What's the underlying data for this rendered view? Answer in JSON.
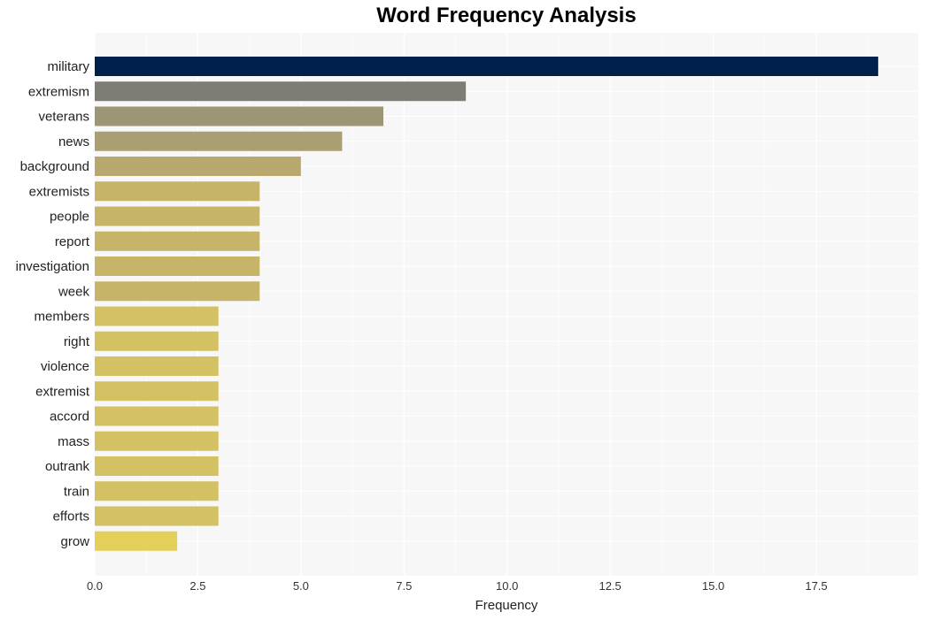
{
  "chart_data": {
    "type": "bar",
    "orientation": "horizontal",
    "title": "Word Frequency Analysis",
    "xlabel": "Frequency",
    "ylabel": "",
    "xlim": [
      0,
      20
    ],
    "xticks": [
      0.0,
      2.5,
      5.0,
      7.5,
      10.0,
      12.5,
      15.0,
      17.5
    ],
    "xtick_labels": [
      "0.0",
      "2.5",
      "5.0",
      "7.5",
      "10.0",
      "12.5",
      "15.0",
      "17.5"
    ],
    "grid": true,
    "categories": [
      "military",
      "extremism",
      "veterans",
      "news",
      "background",
      "extremists",
      "people",
      "report",
      "investigation",
      "week",
      "members",
      "right",
      "violence",
      "extremist",
      "accord",
      "mass",
      "outrank",
      "train",
      "efforts",
      "grow"
    ],
    "values": [
      19,
      9,
      7,
      6,
      5,
      4,
      4,
      4,
      4,
      4,
      3,
      3,
      3,
      3,
      3,
      3,
      3,
      3,
      3,
      2
    ],
    "colors": [
      "#00204c",
      "#7f7c75",
      "#9c9677",
      "#aa9f72",
      "#b8a86d",
      "#c6b469",
      "#c6b469",
      "#c6b469",
      "#c6b469",
      "#c6b469",
      "#d3c164",
      "#d3c164",
      "#d3c164",
      "#d3c164",
      "#d3c164",
      "#d3c164",
      "#d3c164",
      "#d3c164",
      "#d3c164",
      "#e4cf58"
    ]
  }
}
